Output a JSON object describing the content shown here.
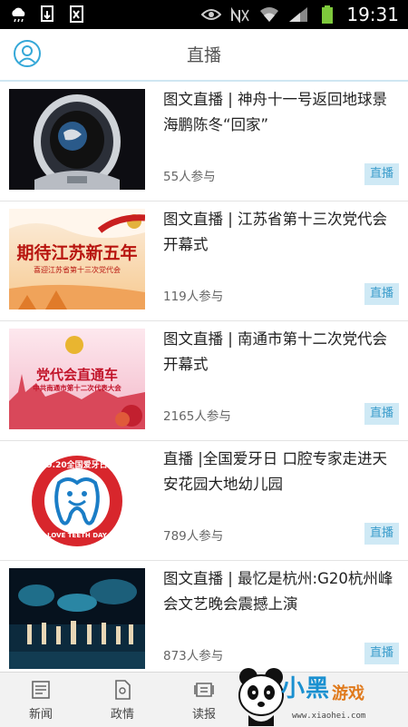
{
  "status_bar": {
    "time": "19:31"
  },
  "header": {
    "title": "直播"
  },
  "items": [
    {
      "title": "图文直播 | 神舟十一号返回地球景海鹏陈冬“回家”",
      "participants": "55人参与",
      "badge": "直播"
    },
    {
      "title": "图文直播 | 江苏省第十三次党代会开幕式",
      "participants": "119人参与",
      "badge": "直播",
      "thumb_text": "期待江苏新五年",
      "thumb_sub": "喜迎江苏省第十三次党代会"
    },
    {
      "title": "图文直播 | 南通市第十二次党代会开幕式",
      "participants": "2165人参与",
      "badge": "直播",
      "thumb_text": "党代会直通车",
      "thumb_sub": "中共南通市第十二次代表大会"
    },
    {
      "title": "直播 |全国爱牙日 口腔专家走进天安花园大地幼儿园",
      "participants": "789人参与",
      "badge": "直播",
      "thumb_text": "9.20全国爱牙日",
      "thumb_sub": "LOVE TEETH DAY"
    },
    {
      "title": "图文直播 | 最忆是杭州:G20杭州峰会文艺晚会震撼上演",
      "participants": "873人参与",
      "badge": "直播"
    }
  ],
  "nav": [
    {
      "label": "新闻",
      "icon": "news-icon"
    },
    {
      "label": "政情",
      "icon": "document-icon"
    },
    {
      "label": "读报",
      "icon": "newspaper-icon"
    }
  ],
  "watermark": {
    "text": "小黑",
    "text2": "游戏",
    "url": "www.xiaohei.com"
  }
}
